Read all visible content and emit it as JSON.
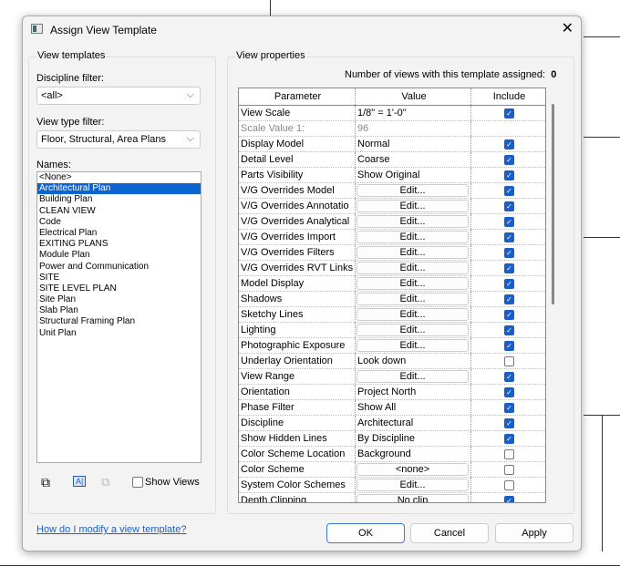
{
  "dialog": {
    "title": "Assign View Template",
    "close_icon": "close-icon"
  },
  "left": {
    "group": "View templates",
    "discipline_label": "Discipline filter:",
    "discipline_value": "<all>",
    "viewtype_label": "View type filter:",
    "viewtype_value": "Floor, Structural, Area Plans",
    "names_label": "Names:",
    "names": [
      "<None>",
      "Architectural Plan",
      "Building Plan",
      "CLEAN VIEW",
      "Code",
      "Electrical Plan",
      "EXITING PLANS",
      "Module Plan",
      "Power and Communication",
      "SITE",
      "SITE LEVEL PLAN",
      "Site Plan",
      "Slab Plan",
      "Structural Framing Plan",
      "Unit Plan"
    ],
    "selected": "Architectural Plan",
    "show_views": "Show Views"
  },
  "right": {
    "group": "View properties",
    "count_label": "Number of views with this template assigned:",
    "count": "0",
    "headers": [
      "Parameter",
      "Value",
      "Include"
    ],
    "rows": [
      {
        "p": "View Scale",
        "v": "1/8\" = 1'-0\"",
        "t": "text",
        "inc": true
      },
      {
        "p": "Scale Value    1:",
        "v": "96",
        "t": "grey",
        "inc": null
      },
      {
        "p": "Display Model",
        "v": "Normal",
        "t": "text",
        "inc": true
      },
      {
        "p": "Detail Level",
        "v": "Coarse",
        "t": "text",
        "inc": true
      },
      {
        "p": "Parts Visibility",
        "v": "Show Original",
        "t": "text",
        "inc": true
      },
      {
        "p": "V/G Overrides Model",
        "v": "Edit...",
        "t": "btn",
        "inc": true
      },
      {
        "p": "V/G Overrides Annotatio",
        "v": "Edit...",
        "t": "btn",
        "inc": true
      },
      {
        "p": "V/G Overrides Analytical",
        "v": "Edit...",
        "t": "btn",
        "inc": true
      },
      {
        "p": "V/G Overrides Import",
        "v": "Edit...",
        "t": "btn",
        "inc": true
      },
      {
        "p": "V/G Overrides Filters",
        "v": "Edit...",
        "t": "btn",
        "inc": true
      },
      {
        "p": "V/G Overrides RVT Links",
        "v": "Edit...",
        "t": "btn",
        "inc": true
      },
      {
        "p": "Model Display",
        "v": "Edit...",
        "t": "btn",
        "inc": true
      },
      {
        "p": "Shadows",
        "v": "Edit...",
        "t": "btn",
        "inc": true
      },
      {
        "p": "Sketchy Lines",
        "v": "Edit...",
        "t": "btn",
        "inc": true
      },
      {
        "p": "Lighting",
        "v": "Edit...",
        "t": "btn",
        "inc": true
      },
      {
        "p": "Photographic Exposure",
        "v": "Edit...",
        "t": "btn",
        "inc": true
      },
      {
        "p": "Underlay Orientation",
        "v": "Look down",
        "t": "text",
        "inc": false
      },
      {
        "p": "View Range",
        "v": "Edit...",
        "t": "btn",
        "inc": true
      },
      {
        "p": "Orientation",
        "v": "Project North",
        "t": "text",
        "inc": true
      },
      {
        "p": "Phase Filter",
        "v": "Show All",
        "t": "text",
        "inc": true
      },
      {
        "p": "Discipline",
        "v": "Architectural",
        "t": "text",
        "inc": true
      },
      {
        "p": "Show Hidden Lines",
        "v": "By Discipline",
        "t": "text",
        "inc": true
      },
      {
        "p": "Color Scheme Location",
        "v": "Background",
        "t": "text",
        "inc": false
      },
      {
        "p": "Color Scheme",
        "v": "<none>",
        "t": "btn",
        "inc": false
      },
      {
        "p": "System Color Schemes",
        "v": "Edit...",
        "t": "btn",
        "inc": false
      },
      {
        "p": "Depth Clipping",
        "v": "No clip",
        "t": "btn",
        "inc": true
      }
    ]
  },
  "footer": {
    "help_link": "How do I modify a view template?",
    "ok": "OK",
    "cancel": "Cancel",
    "apply": "Apply"
  },
  "colors": {
    "accent": "#0a64d2",
    "link": "#1a5fc9"
  }
}
